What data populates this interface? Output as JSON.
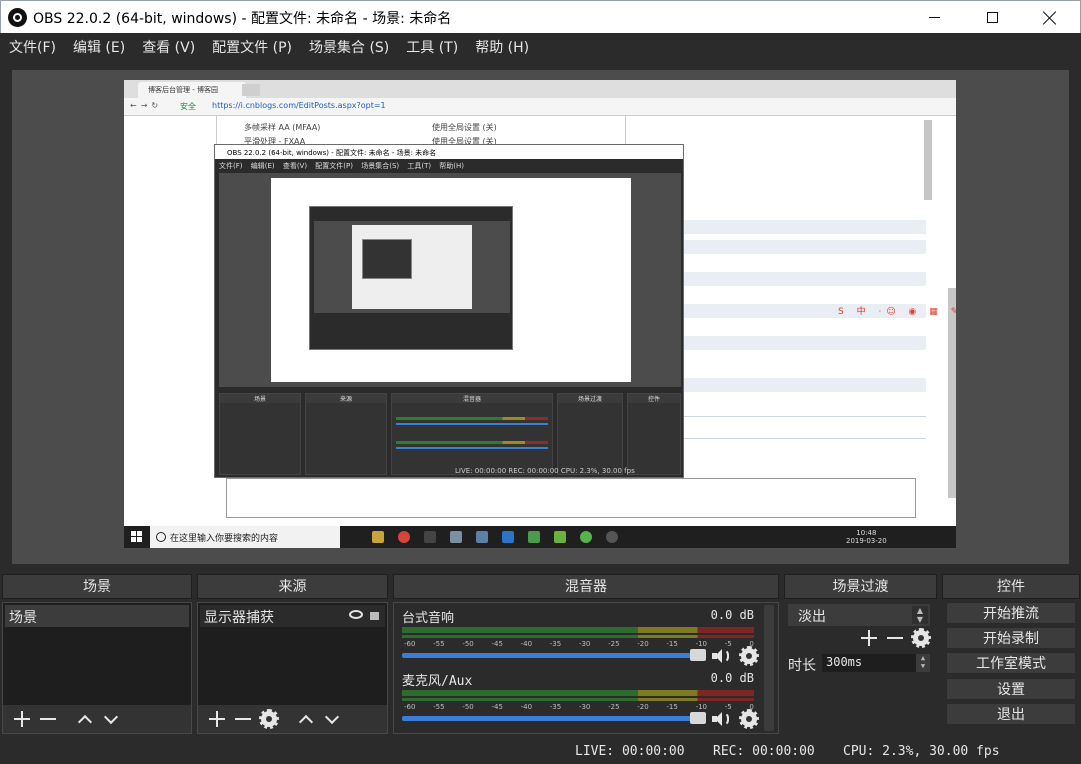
{
  "window": {
    "title": "OBS 22.0.2 (64-bit, windows) - 配置文件: 未命名 - 场景: 未命名",
    "controls": [
      "minimize",
      "maximize",
      "close"
    ]
  },
  "menu": [
    {
      "label": "文件(F)"
    },
    {
      "label": "编辑 (E)"
    },
    {
      "label": "查看 (V)"
    },
    {
      "label": "配置文件 (P)"
    },
    {
      "label": "场景集合 (S)"
    },
    {
      "label": "工具 (T)"
    },
    {
      "label": "帮助 (H)"
    }
  ],
  "preview": {
    "browser_tab": "博客后台管理 - 博客园",
    "secure_label": "安全",
    "url": "https://i.cnblogs.com/EditPosts.aspx?opt=1",
    "settings_rows": [
      {
        "name": "多帧采样 AA (MFAA)",
        "value": "使用全局设置 (关)"
      },
      {
        "name": "平滑处理 - FXAA",
        "value": "使用全局设置 (关)"
      }
    ],
    "nested_title": "OBS 22.0.2 (64-bit, windows) - 配置文件: 未命名 - 场景: 未命名",
    "nested_menu": "文件(F) 编辑(E) 查看(V) 配置文件(P) 场景集合(S) 工具(T) 帮助(H)",
    "nested_status": "LIVE: 00:00:00   REC: 00:00:00   CPU: 2.3%, 30.00 fps",
    "nested_docks": [
      "场景",
      "来源",
      "混音器",
      "场景过渡",
      "控件"
    ],
    "taskbar_search": "在这里输入你要搜索的内容",
    "taskbar_time": "10:48",
    "taskbar_date": "2019-03-20",
    "sogou_label": "中"
  },
  "docks": {
    "scenes": {
      "header": "场景",
      "items": [
        "场景"
      ]
    },
    "sources": {
      "header": "来源",
      "items": [
        "显示器捕获"
      ]
    },
    "mixer": {
      "header": "混音器",
      "channels": [
        {
          "name": "台式音响",
          "db": "0.0 dB",
          "level": 1.0
        },
        {
          "name": "麦克风/Aux",
          "db": "0.0 dB",
          "level": 1.0
        }
      ],
      "ticks": [
        "-60",
        "-55",
        "-50",
        "-45",
        "-40",
        "-35",
        "-30",
        "-25",
        "-20",
        "-15",
        "-10",
        "-5",
        "0"
      ]
    },
    "transitions": {
      "header": "场景过渡",
      "selected": "淡出",
      "duration_label": "时长",
      "duration_value": "300ms"
    },
    "controls": {
      "header": "控件",
      "buttons": [
        "开始推流",
        "开始录制",
        "工作室模式",
        "设置",
        "退出"
      ]
    }
  },
  "status": {
    "live": "LIVE: 00:00:00",
    "rec": "REC: 00:00:00",
    "cpu": "CPU: 2.3%, 30.00 fps"
  },
  "colors": {
    "background": "#2b2b2b",
    "panel_header": "#3c3c3c",
    "list_bg": "#1e1e1e",
    "volume_accent": "#3a7fd5",
    "meter_green": "#2e6b2e",
    "meter_yellow": "#7d7a22",
    "meter_red": "#7d2626"
  }
}
